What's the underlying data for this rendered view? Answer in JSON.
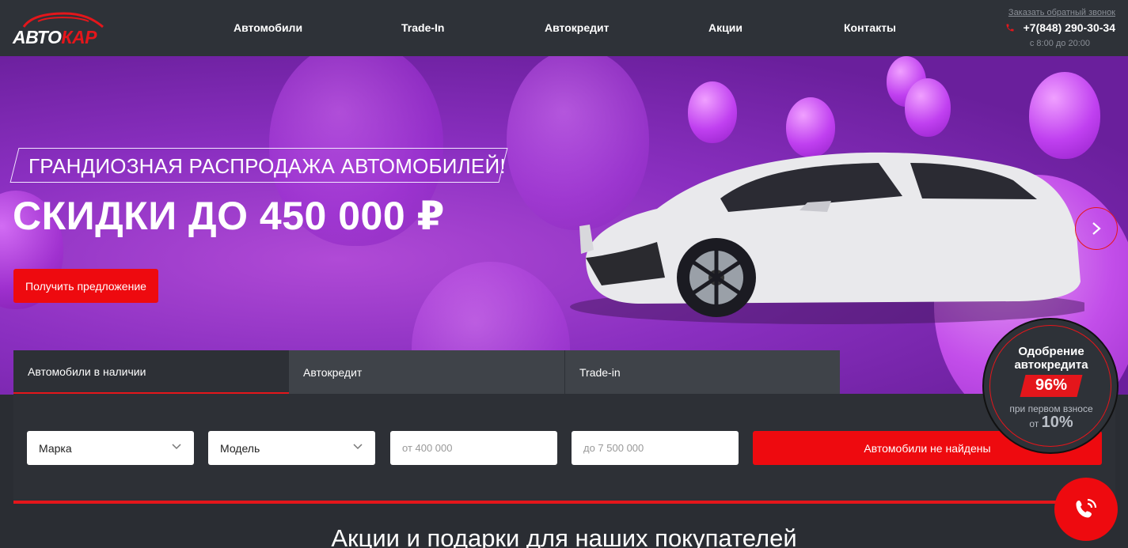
{
  "header": {
    "logo": {
      "part1": "АВТО",
      "part2": "КАР"
    },
    "nav": [
      "Автомобили",
      "Trade-In",
      "Автокредит",
      "Акции",
      "Контакты"
    ],
    "callback_label": "Заказать обратный звонок",
    "phone": "+7(848) 290-30-34",
    "hours": "с 8:00 до 20:00",
    "phone_icon": "phone-icon"
  },
  "hero": {
    "badge_text": "ГРАНДИОЗНАЯ РАСПРОДАЖА АВТОМОБИЛЕЙ!",
    "title": "СКИДКИ ДО 450 000 ₽",
    "cta_label": "Получить предложение",
    "next_icon": "chevron-right-icon"
  },
  "tabs": [
    "Автомобили в наличии",
    "Автокредит",
    "Trade-in"
  ],
  "filter": {
    "brand_label": "Марка",
    "model_label": "Модель",
    "price_from_placeholder": "от 400 000",
    "price_to_placeholder": "до 7 500 000",
    "search_label": "Автомобили не найдены"
  },
  "approval": {
    "title_line1": "Одобрение",
    "title_line2": "автокредита",
    "percent": "96%",
    "sub": "при первом взносе",
    "from_prefix": "от",
    "from_value": "10%"
  },
  "section_title": "Акции и подарки для наших покупателей",
  "colors": {
    "accent": "#ee0a0f",
    "header_bg": "#2e3238",
    "hero_purple": "#8a2fc0"
  }
}
